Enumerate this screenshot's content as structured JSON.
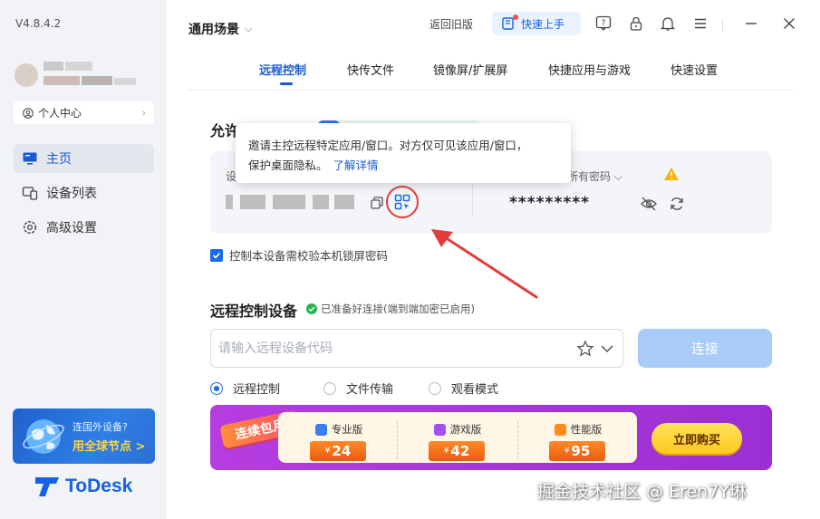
{
  "app": {
    "version": "V4.8.4.2",
    "brand_name": "ToDesk"
  },
  "sidebar": {
    "profile_label": "个人中心",
    "items": [
      {
        "label": "主页",
        "active": true,
        "icon": "monitor-icon"
      },
      {
        "label": "设备列表",
        "active": false,
        "icon": "device-list-icon"
      },
      {
        "label": "高级设置",
        "active": false,
        "icon": "gear-icon"
      }
    ],
    "promo": {
      "line1": "连国外设备?",
      "line2": "用全球节点 >"
    }
  },
  "header": {
    "scene_label": "通用场景",
    "back_old_label": "返回旧版",
    "quick_start_label": "快速上手",
    "icons": [
      "help-icon",
      "lock-icon",
      "bell-icon",
      "menu-icon",
      "minimize-icon",
      "close-icon"
    ]
  },
  "tabs": [
    {
      "label": "远程控制",
      "active": true
    },
    {
      "label": "快传文件",
      "active": false
    },
    {
      "label": "镜像屏/扩展屏",
      "active": false
    },
    {
      "label": "快捷应用与游戏",
      "active": false
    },
    {
      "label": "快速设置",
      "active": false
    }
  ],
  "allow_section": {
    "title": "允许控制本设备",
    "device_code_label": "设",
    "password_label": "所有密码",
    "password_value": "*********",
    "lock_check_label": "控制本设备需校验本机锁屏密码",
    "lock_check_checked": true
  },
  "tooltip": {
    "text_line1": "邀请主控远程特定应用/窗口。对方仅可见该应用/窗口，",
    "text_line2": "保护桌面隐私。",
    "link": "了解详情"
  },
  "remote_section": {
    "title": "远程控制设备",
    "status": "已准备好连接(端到端加密已启用)",
    "input_placeholder": "请输入远程设备代码",
    "input_value": "",
    "connect_label": "连接",
    "modes": [
      {
        "label": "远程控制",
        "selected": true
      },
      {
        "label": "文件传输",
        "selected": false
      },
      {
        "label": "观看模式",
        "selected": false
      }
    ]
  },
  "bundle": {
    "tag": "连续包月",
    "plans": [
      {
        "name": "专业版",
        "currency": "¥",
        "price": "24",
        "color": "#3d7bf0"
      },
      {
        "name": "游戏版",
        "currency": "¥",
        "price": "42",
        "color": "#a450f0"
      },
      {
        "name": "性能版",
        "currency": "¥",
        "price": "95",
        "color": "#ff8a1a"
      }
    ],
    "buy_label": "立即购买"
  },
  "watermark": "掘金技术社区 @ Eren7Y琳"
}
